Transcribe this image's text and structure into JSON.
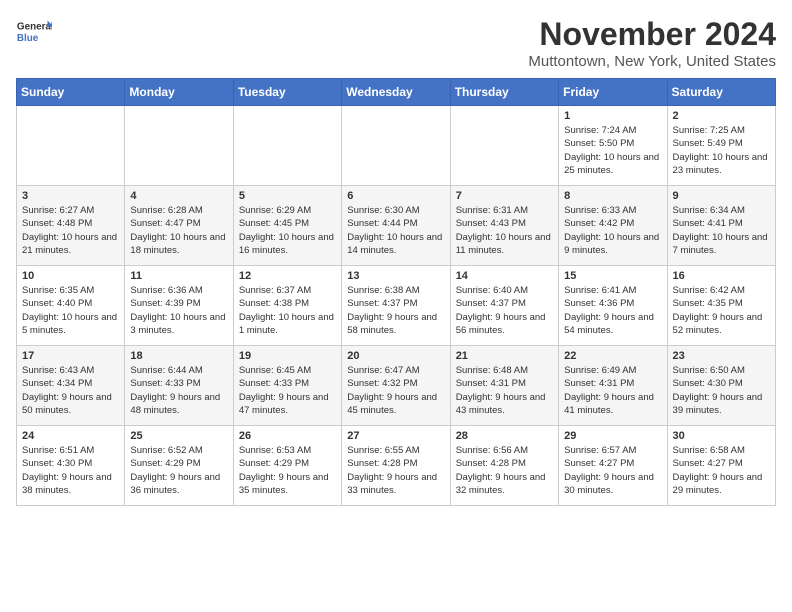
{
  "logo": {
    "line1": "General",
    "line2": "Blue"
  },
  "title": "November 2024",
  "subtitle": "Muttontown, New York, United States",
  "headers": [
    "Sunday",
    "Monday",
    "Tuesday",
    "Wednesday",
    "Thursday",
    "Friday",
    "Saturday"
  ],
  "weeks": [
    [
      {
        "day": "",
        "info": ""
      },
      {
        "day": "",
        "info": ""
      },
      {
        "day": "",
        "info": ""
      },
      {
        "day": "",
        "info": ""
      },
      {
        "day": "",
        "info": ""
      },
      {
        "day": "1",
        "info": "Sunrise: 7:24 AM\nSunset: 5:50 PM\nDaylight: 10 hours and 25 minutes."
      },
      {
        "day": "2",
        "info": "Sunrise: 7:25 AM\nSunset: 5:49 PM\nDaylight: 10 hours and 23 minutes."
      }
    ],
    [
      {
        "day": "3",
        "info": "Sunrise: 6:27 AM\nSunset: 4:48 PM\nDaylight: 10 hours and 21 minutes."
      },
      {
        "day": "4",
        "info": "Sunrise: 6:28 AM\nSunset: 4:47 PM\nDaylight: 10 hours and 18 minutes."
      },
      {
        "day": "5",
        "info": "Sunrise: 6:29 AM\nSunset: 4:45 PM\nDaylight: 10 hours and 16 minutes."
      },
      {
        "day": "6",
        "info": "Sunrise: 6:30 AM\nSunset: 4:44 PM\nDaylight: 10 hours and 14 minutes."
      },
      {
        "day": "7",
        "info": "Sunrise: 6:31 AM\nSunset: 4:43 PM\nDaylight: 10 hours and 11 minutes."
      },
      {
        "day": "8",
        "info": "Sunrise: 6:33 AM\nSunset: 4:42 PM\nDaylight: 10 hours and 9 minutes."
      },
      {
        "day": "9",
        "info": "Sunrise: 6:34 AM\nSunset: 4:41 PM\nDaylight: 10 hours and 7 minutes."
      }
    ],
    [
      {
        "day": "10",
        "info": "Sunrise: 6:35 AM\nSunset: 4:40 PM\nDaylight: 10 hours and 5 minutes."
      },
      {
        "day": "11",
        "info": "Sunrise: 6:36 AM\nSunset: 4:39 PM\nDaylight: 10 hours and 3 minutes."
      },
      {
        "day": "12",
        "info": "Sunrise: 6:37 AM\nSunset: 4:38 PM\nDaylight: 10 hours and 1 minute."
      },
      {
        "day": "13",
        "info": "Sunrise: 6:38 AM\nSunset: 4:37 PM\nDaylight: 9 hours and 58 minutes."
      },
      {
        "day": "14",
        "info": "Sunrise: 6:40 AM\nSunset: 4:37 PM\nDaylight: 9 hours and 56 minutes."
      },
      {
        "day": "15",
        "info": "Sunrise: 6:41 AM\nSunset: 4:36 PM\nDaylight: 9 hours and 54 minutes."
      },
      {
        "day": "16",
        "info": "Sunrise: 6:42 AM\nSunset: 4:35 PM\nDaylight: 9 hours and 52 minutes."
      }
    ],
    [
      {
        "day": "17",
        "info": "Sunrise: 6:43 AM\nSunset: 4:34 PM\nDaylight: 9 hours and 50 minutes."
      },
      {
        "day": "18",
        "info": "Sunrise: 6:44 AM\nSunset: 4:33 PM\nDaylight: 9 hours and 48 minutes."
      },
      {
        "day": "19",
        "info": "Sunrise: 6:45 AM\nSunset: 4:33 PM\nDaylight: 9 hours and 47 minutes."
      },
      {
        "day": "20",
        "info": "Sunrise: 6:47 AM\nSunset: 4:32 PM\nDaylight: 9 hours and 45 minutes."
      },
      {
        "day": "21",
        "info": "Sunrise: 6:48 AM\nSunset: 4:31 PM\nDaylight: 9 hours and 43 minutes."
      },
      {
        "day": "22",
        "info": "Sunrise: 6:49 AM\nSunset: 4:31 PM\nDaylight: 9 hours and 41 minutes."
      },
      {
        "day": "23",
        "info": "Sunrise: 6:50 AM\nSunset: 4:30 PM\nDaylight: 9 hours and 39 minutes."
      }
    ],
    [
      {
        "day": "24",
        "info": "Sunrise: 6:51 AM\nSunset: 4:30 PM\nDaylight: 9 hours and 38 minutes."
      },
      {
        "day": "25",
        "info": "Sunrise: 6:52 AM\nSunset: 4:29 PM\nDaylight: 9 hours and 36 minutes."
      },
      {
        "day": "26",
        "info": "Sunrise: 6:53 AM\nSunset: 4:29 PM\nDaylight: 9 hours and 35 minutes."
      },
      {
        "day": "27",
        "info": "Sunrise: 6:55 AM\nSunset: 4:28 PM\nDaylight: 9 hours and 33 minutes."
      },
      {
        "day": "28",
        "info": "Sunrise: 6:56 AM\nSunset: 4:28 PM\nDaylight: 9 hours and 32 minutes."
      },
      {
        "day": "29",
        "info": "Sunrise: 6:57 AM\nSunset: 4:27 PM\nDaylight: 9 hours and 30 minutes."
      },
      {
        "day": "30",
        "info": "Sunrise: 6:58 AM\nSunset: 4:27 PM\nDaylight: 9 hours and 29 minutes."
      }
    ]
  ]
}
